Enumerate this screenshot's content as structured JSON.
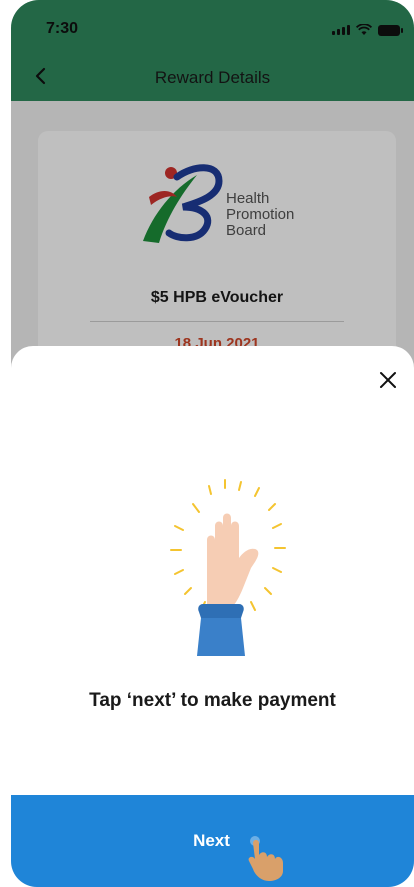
{
  "status_bar": {
    "time": "7:30"
  },
  "header": {
    "title": "Reward Details"
  },
  "reward": {
    "logo_lines": [
      "Health",
      "Promotion",
      "Board"
    ],
    "title": "$5 HPB eVoucher",
    "date": "18 Jun 2021"
  },
  "sheet": {
    "instruction": "Tap ‘next’ to make payment",
    "next_label": "Next"
  },
  "colors": {
    "header_green": "#2f8a5e",
    "button_blue": "#1f85d8",
    "date_red": "#d2472a"
  }
}
